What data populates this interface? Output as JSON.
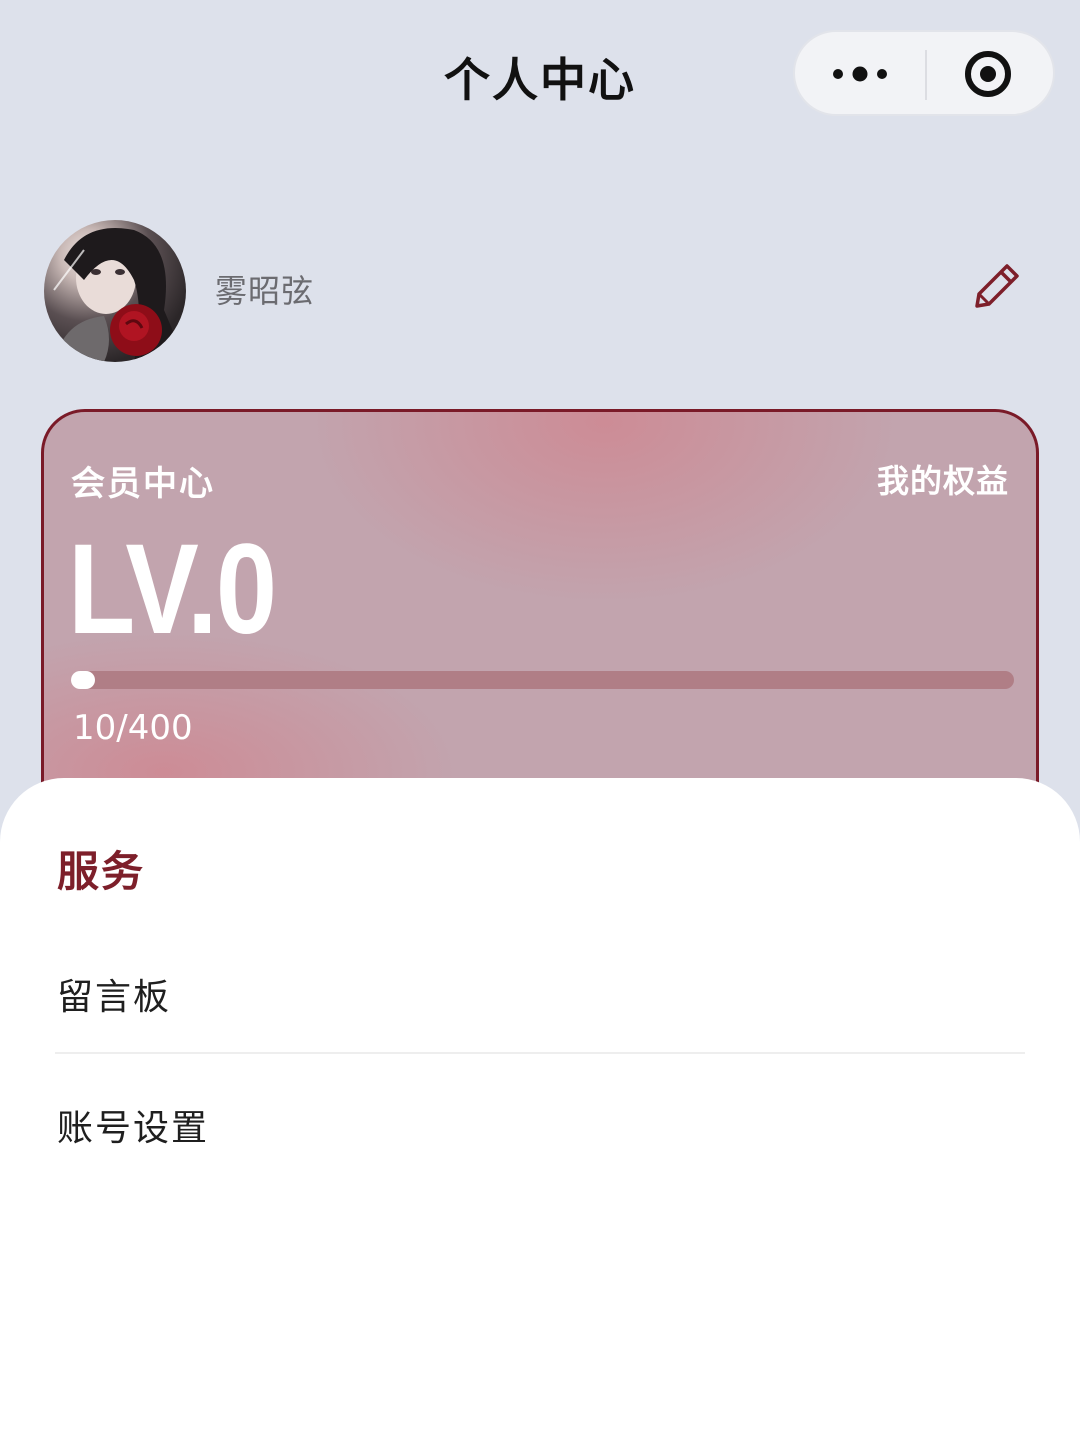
{
  "navbar": {
    "title": "个人中心",
    "more_icon": "more-dots-icon",
    "close_icon": "target-circle-icon"
  },
  "profile": {
    "username": "雾昭弦",
    "avatar_icon": "user-avatar",
    "edit_icon": "pencil-icon"
  },
  "member_card": {
    "title": "会员中心",
    "benefits_label": "我的权益",
    "level": "LV.0",
    "progress_text": "10/400",
    "progress_fraction": 0.025,
    "accent_color": "#7a1a28"
  },
  "services": {
    "title": "服务",
    "items": [
      {
        "label": "留言板"
      },
      {
        "label": "账号设置"
      }
    ]
  },
  "colors": {
    "page_bg": "#dde1eb",
    "section_title": "#7d1f2a",
    "card_bg": "#c2a4ae"
  }
}
